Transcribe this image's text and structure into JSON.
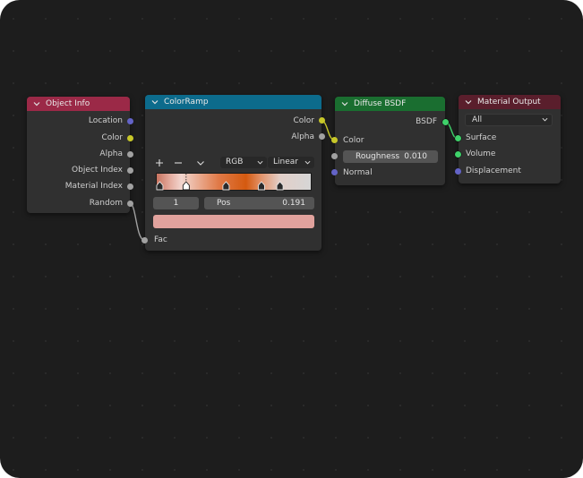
{
  "colors": {
    "object_info_header": "#9b2947",
    "color_ramp_header": "#0c6b8c",
    "diffuse_header": "#1a6e30",
    "material_output_header": "#5a1e2c",
    "socket_color": "#c7c729",
    "socket_float": "#a1a1a1",
    "socket_vector": "#6363c7",
    "socket_shader": "#3fd16a",
    "color_swatch": "#e1a29d"
  },
  "nodes": {
    "object_info": {
      "title": "Object Info",
      "outputs": [
        "Location",
        "Color",
        "Alpha",
        "Object Index",
        "Material Index",
        "Random"
      ]
    },
    "color_ramp": {
      "title": "ColorRamp",
      "outputs": [
        "Color",
        "Alpha"
      ],
      "add_icon": "plus-icon",
      "remove_icon": "minus-icon",
      "menu_icon": "chevron-down-icon",
      "color_mode": "RGB",
      "interpolation": "Linear",
      "stop_index": "1",
      "pos_label": "Pos",
      "pos_value": "0.191",
      "stops": [
        0.02,
        0.191,
        0.45,
        0.68,
        0.8
      ],
      "input": "Fac"
    },
    "diffuse_bsdf": {
      "title": "Diffuse BSDF",
      "output": "BSDF",
      "inputs": {
        "color": "Color",
        "roughness_label": "Roughness",
        "roughness_value": "0.010",
        "normal": "Normal"
      }
    },
    "material_output": {
      "title": "Material Output",
      "target": "All",
      "inputs": [
        "Surface",
        "Volume",
        "Displacement"
      ]
    }
  }
}
